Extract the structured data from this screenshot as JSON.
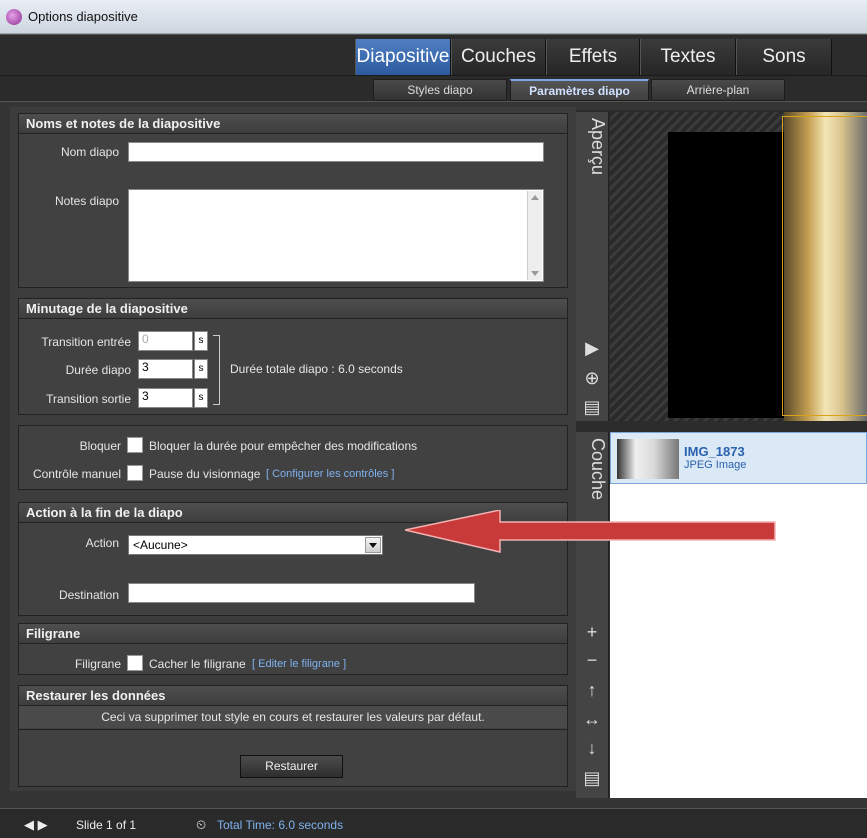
{
  "window": {
    "title": "Options diapositive"
  },
  "main_tabs": [
    {
      "label": "Diapositive",
      "active": true
    },
    {
      "label": "Couches",
      "active": false
    },
    {
      "label": "Effets",
      "active": false
    },
    {
      "label": "Textes",
      "active": false
    },
    {
      "label": "Sons",
      "active": false
    }
  ],
  "sub_tabs": [
    {
      "label": "Styles diapo",
      "active": false
    },
    {
      "label": "Paramètres diapo",
      "active": true
    },
    {
      "label": "Arrière-plan",
      "active": false
    }
  ],
  "names": {
    "title": "Noms et notes de la diapositive",
    "name_label": "Nom diapo",
    "name_value": "",
    "notes_label": "Notes diapo",
    "notes_value": ""
  },
  "timing": {
    "title": "Minutage de la diapositive",
    "in_label": "Transition entrée",
    "in_value": "0",
    "dur_label": "Durée diapo",
    "dur_value": "3",
    "out_label": "Transition sortie",
    "out_value": "3",
    "unit": "s",
    "total": "Durée totale diapo : 6.0 seconds",
    "lock_label": "Bloquer",
    "lock_text": "Bloquer la durée pour empêcher des modifications",
    "manual_label": "Contrôle manuel",
    "manual_text": "Pause du visionnage",
    "manual_link": "[ Configurer les contrôles ]"
  },
  "action": {
    "title": "Action à la fin de la diapo",
    "action_label": "Action",
    "action_value": "<Aucune>",
    "dest_label": "Destination",
    "dest_value": ""
  },
  "watermark": {
    "title": "Filigrane",
    "label": "Filigrane",
    "text": "Cacher le filigrane",
    "link": "[ Editer le filigrane ]"
  },
  "restore": {
    "title": "Restaurer les données",
    "desc": "Ceci va supprimer tout style en cours et restaurer les valeurs par défaut.",
    "button": "Restaurer"
  },
  "preview": {
    "label": "Aperçu"
  },
  "layers": {
    "label": "Couche",
    "items": [
      {
        "name": "IMG_1873",
        "type": "JPEG Image"
      }
    ]
  },
  "status": {
    "slide": "Slide 1 of 1",
    "total": "Total Time: 6.0 seconds"
  },
  "colors": {
    "accent": "#4f7ec3",
    "link": "#7fb2ef",
    "arrow": "#c83a3a"
  }
}
